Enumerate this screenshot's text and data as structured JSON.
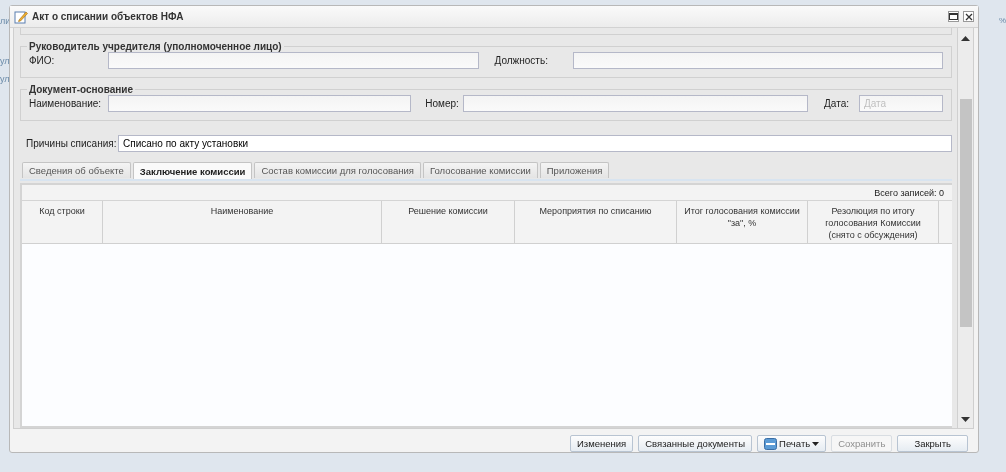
{
  "background": {
    "fragments_left": [
      "ли",
      "ул",
      "ул"
    ],
    "fragment_right": "%"
  },
  "window": {
    "title": "Акт о списании объектов НФА"
  },
  "head": {
    "legend": "Руководитель учредителя (уполномоченное лицо)",
    "fields": [
      {
        "label": "ФИО:"
      },
      {
        "label": "Должность:"
      }
    ]
  },
  "basis": {
    "legend": "Документ-основание",
    "fields": [
      {
        "label": "Наименование:"
      },
      {
        "label": "Номер:"
      },
      {
        "label": "Дата:",
        "placeholder": "Дата"
      }
    ]
  },
  "reason": {
    "label": "Причины списания:",
    "value": "Списано по акту установки"
  },
  "tabs": [
    {
      "label": "Сведения об объекте",
      "selected": false
    },
    {
      "label": "Заключение комиссии",
      "selected": true
    },
    {
      "label": "Состав комиссии для голосования",
      "selected": false
    },
    {
      "label": "Голосование комиссии",
      "selected": false
    },
    {
      "label": "Приложения",
      "selected": false
    }
  ],
  "grid": {
    "total": "Всего записей: 0",
    "columns": [
      "Код строки",
      "Наименование",
      "Решение комиссии",
      "Мероприятия по списанию",
      "Итог голосования комиссии \"за\", %",
      "Резолюция по итогу голосования Комиссии (снято с обсуждения)"
    ]
  },
  "buttons": [
    {
      "label": "Изменения",
      "kind": "plain",
      "disabled": false
    },
    {
      "label": "Связанные документы",
      "kind": "plain",
      "disabled": false
    },
    {
      "label": "Печать",
      "kind": "menu",
      "disabled": false
    },
    {
      "label": "Сохранить",
      "kind": "plain",
      "disabled": true
    },
    {
      "label": "Закрыть",
      "kind": "plain",
      "disabled": false
    }
  ]
}
